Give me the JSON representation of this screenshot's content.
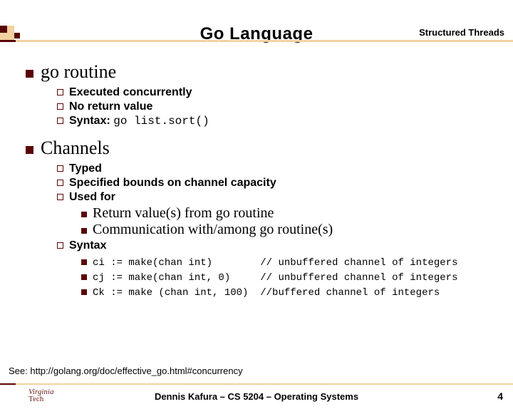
{
  "header": {
    "section_title": "Structured Threads"
  },
  "slide_title": "Go Language",
  "bullets": {
    "b1": {
      "label": "go routine",
      "sub": {
        "s1": "Executed concurrently",
        "s2": "No return value",
        "s3_prefix": "Syntax: ",
        "s3_code": "go list.sort()"
      }
    },
    "b2": {
      "label": "Channels",
      "sub": {
        "s1": "Typed",
        "s2": "Specified bounds on channel capacity",
        "s3": "Used for",
        "s3_sub": {
          "a": "Return value(s) from go routine",
          "b": "Communication with/among go routine(s)"
        },
        "s4": "Syntax",
        "s4_sub": {
          "a": "ci := make(chan int)        // unbuffered channel of integers",
          "b": "cj := make(chan int, 0)     // unbuffered channel of integers",
          "c": "Ck := make (chan int, 100)  //buffered channel of integers"
        }
      }
    }
  },
  "see": "See: http://golang.org/doc/effective_go.html#concurrency",
  "footer": {
    "text": "Dennis Kafura – CS 5204 – Operating Systems",
    "page": "4",
    "logo_top": "Virginia",
    "logo_bottom": "Tech"
  }
}
